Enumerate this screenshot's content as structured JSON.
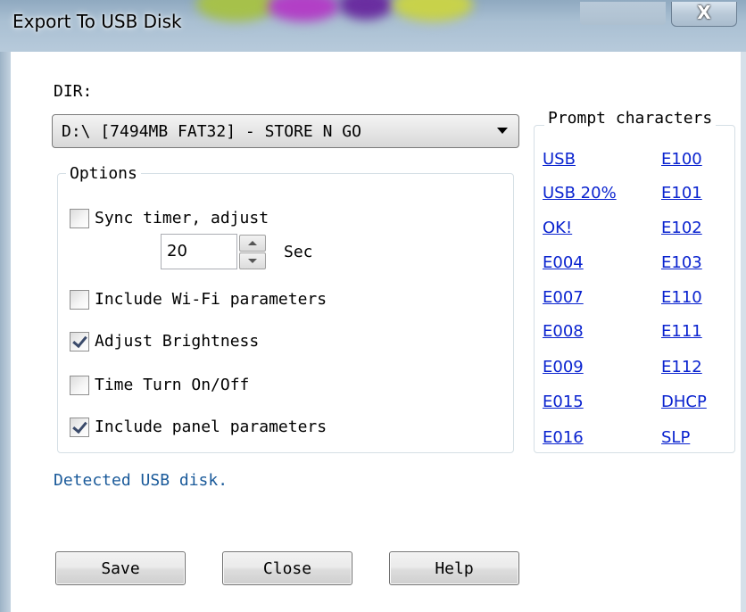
{
  "window": {
    "title": "Export To USB Disk",
    "close_glyph": "X"
  },
  "dir": {
    "label": "DIR:",
    "selected": "D:\\ [7494MB FAT32] - STORE N GO"
  },
  "options": {
    "legend": "Options",
    "sync_timer": {
      "label": "Sync timer, adjust",
      "checked": false
    },
    "timer_value": "20",
    "timer_unit": "Sec",
    "wifi": {
      "label": "Include Wi-Fi parameters",
      "checked": false
    },
    "brightness": {
      "label": "Adjust Brightness",
      "checked": true
    },
    "time_turn": {
      "label": "Time Turn On/Off",
      "checked": false
    },
    "panel": {
      "label": "Include panel parameters",
      "checked": true
    }
  },
  "prompt": {
    "legend": "Prompt characters",
    "left": [
      "USB",
      "USB 20%",
      "OK!",
      "E004",
      "E007",
      "E008",
      "E009",
      "E015",
      "E016"
    ],
    "right": [
      "E100",
      "E101",
      "E102",
      "E103",
      "E110",
      "E111",
      "E112",
      "DHCP",
      "SLP"
    ]
  },
  "status": "Detected USB disk.",
  "buttons": {
    "save": "Save",
    "close": "Close",
    "help": "Help"
  },
  "colors": {
    "link": "#0a23cf",
    "status": "#1a5a9a"
  },
  "icons": {
    "dropdown": "chevron-down-icon",
    "spin_up": "arrow-up-icon",
    "spin_down": "arrow-down-icon",
    "check": "checkmark-icon"
  }
}
